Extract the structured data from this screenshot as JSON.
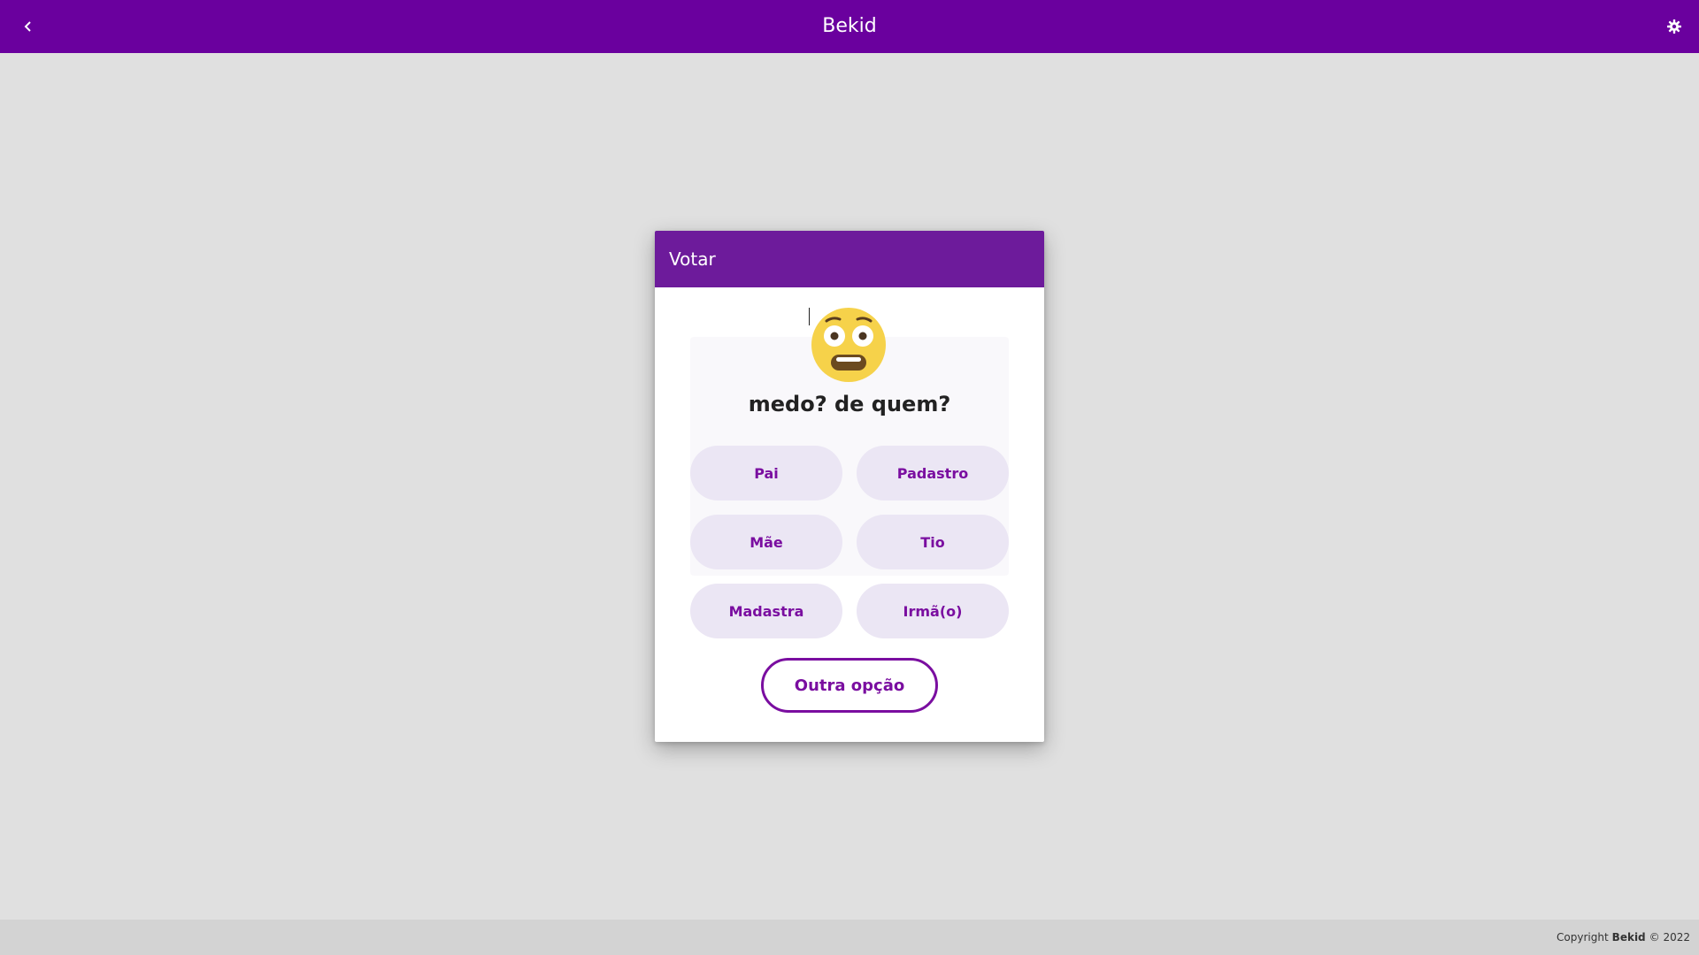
{
  "app": {
    "title": "Bekid",
    "back_icon": "chevron-left-icon",
    "settings_icon": "gear-icon",
    "brand_color": "#6a009e"
  },
  "dialog": {
    "title": "Votar",
    "header_color": "#6d1b9b",
    "emoji": "flushed-face-icon",
    "question": "medo? de quem?",
    "options": [
      "Pai",
      "Padastro",
      "Mãe",
      "Tio",
      "Madastra",
      "Irmã(o)"
    ],
    "other_option": "Outra opção",
    "accent_color": "#7a0ea0"
  },
  "footer": {
    "prefix": "Copyright",
    "brand": "Bekid",
    "suffix": "© 2022"
  }
}
